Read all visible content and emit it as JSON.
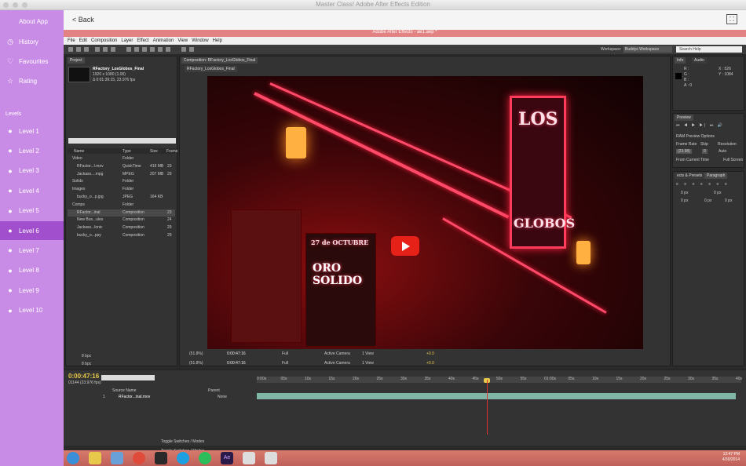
{
  "window": {
    "title": "Master Class! Adobe After Effects Edition"
  },
  "sidebar": {
    "items": [
      {
        "label": "About App",
        "icon": "apple-icon"
      },
      {
        "label": "History",
        "icon": "clock-icon"
      },
      {
        "label": "Favourites",
        "icon": "heart-icon"
      },
      {
        "label": "Rating",
        "icon": "star-icon"
      }
    ],
    "levels_header": "Levels",
    "levels": [
      {
        "label": "Level 1",
        "active": false
      },
      {
        "label": "Level 2",
        "active": false
      },
      {
        "label": "Level 3",
        "active": false
      },
      {
        "label": "Level 4",
        "active": false
      },
      {
        "label": "Level 5",
        "active": false
      },
      {
        "label": "Level 6",
        "active": true
      },
      {
        "label": "Level 7",
        "active": false
      },
      {
        "label": "Level 8",
        "active": false
      },
      {
        "label": "Level 9",
        "active": false
      },
      {
        "label": "Level 10",
        "active": false
      }
    ]
  },
  "navbar": {
    "back_label": "< Back"
  },
  "ae": {
    "title": "Adobe After Effects - ae1.aep *",
    "menu": [
      "File",
      "Edit",
      "Composition",
      "Layer",
      "Effect",
      "Animation",
      "View",
      "Window",
      "Help"
    ],
    "workspace_label": "Workspace:",
    "workspace_value": "Buddys Workspace",
    "search_placeholder": "Search Help",
    "project": {
      "tab": "Project",
      "comp_name": "RFactory_LosGlobos_Final",
      "comp_info_1": "1920 x 1080 (1.00)",
      "comp_info_2": "Δ 0:01:39:15, 23.976 fps",
      "columns": [
        "Name",
        "Type",
        "Size",
        "Frame"
      ],
      "rows": [
        {
          "name": "Video",
          "type": "Folder",
          "size": "",
          "frame": ""
        },
        {
          "name": "RFactor...l.mov",
          "type": "QuickTime",
          "size": "419 MB",
          "frame": "23"
        },
        {
          "name": "Jackass....mpg",
          "type": "MPEG",
          "size": "207 MB",
          "frame": "29"
        },
        {
          "name": "Solids",
          "type": "Folder",
          "size": "",
          "frame": ""
        },
        {
          "name": "Images",
          "type": "Folder",
          "size": "",
          "frame": ""
        },
        {
          "name": "bucky_o...p.jpg",
          "type": "JPEG",
          "size": "164 KB",
          "frame": ""
        },
        {
          "name": "Comps",
          "type": "Folder",
          "size": "",
          "frame": ""
        },
        {
          "name": "RFactor...inal",
          "type": "Composition",
          "size": "",
          "frame": "23"
        },
        {
          "name": "New Bos...ules",
          "type": "Composition",
          "size": "",
          "frame": "24"
        },
        {
          "name": "Jackass...lonic",
          "type": "Composition",
          "size": "",
          "frame": "29"
        },
        {
          "name": "bucky_o...ppy",
          "type": "Composition",
          "size": "",
          "frame": "29"
        }
      ],
      "bpc": "8 bpc"
    },
    "composition": {
      "tab": "Composition: RFactory_LosGlobos_Final",
      "subtab": "RFactory_LosGlobos_Final",
      "zoom": "(51.8%)",
      "timecode": "0:00:47:16",
      "resolution": "Full",
      "camera": "Active Camera",
      "views": "1 View",
      "offset": "+0.0",
      "sign_top": "LOS",
      "sign_bottom": "GLOBOS",
      "poster_text_1": "27 de OCTUBRE",
      "poster_text_2": "ORO SOLIDO"
    },
    "info": {
      "tab_info": "Info",
      "tab_audio": "Audio",
      "r": "R :",
      "g": "G :",
      "b": "B :",
      "a": "A : 0",
      "x": "X : 526",
      "y": "Y : 1084"
    },
    "preview": {
      "tab": "Preview",
      "ram": "RAM Preview Options",
      "frame_rate_label": "Frame Rate",
      "skip_label": "Skip",
      "resolution_label": "Resolution",
      "frame_rate": "(23.98)",
      "skip": "0",
      "resolution": "Auto",
      "from_current": "From Current Time",
      "full_screen": "Full Screen"
    },
    "paragraph": {
      "tab_effects": "ects & Presets",
      "tab_paragraph": "Paragraph",
      "px_values": [
        "0 px",
        "0 px",
        "0 px",
        "0 px",
        "0 px"
      ]
    },
    "timeline": {
      "timecode": "0:00:47:16",
      "frames": "01144 (23.976 fps)",
      "col_source": "Source Name",
      "col_parent": "Parent",
      "layer_num": "1",
      "layer_name": "RFactor...inal.mov",
      "parent_value": "None",
      "ticks": [
        "0:00s",
        "05s",
        "10s",
        "15s",
        "20s",
        "25s",
        "30s",
        "35s",
        "40s",
        "45s",
        "50s",
        "55s",
        "01:00s",
        "05s",
        "10s",
        "15s",
        "20s",
        "25s",
        "30s",
        "35s",
        "40s"
      ],
      "toggle": "Toggle Switches / Modes",
      "progress": 0.48
    },
    "taskbar": {
      "time": "12:47 PM",
      "date": "4/30/2014"
    }
  }
}
